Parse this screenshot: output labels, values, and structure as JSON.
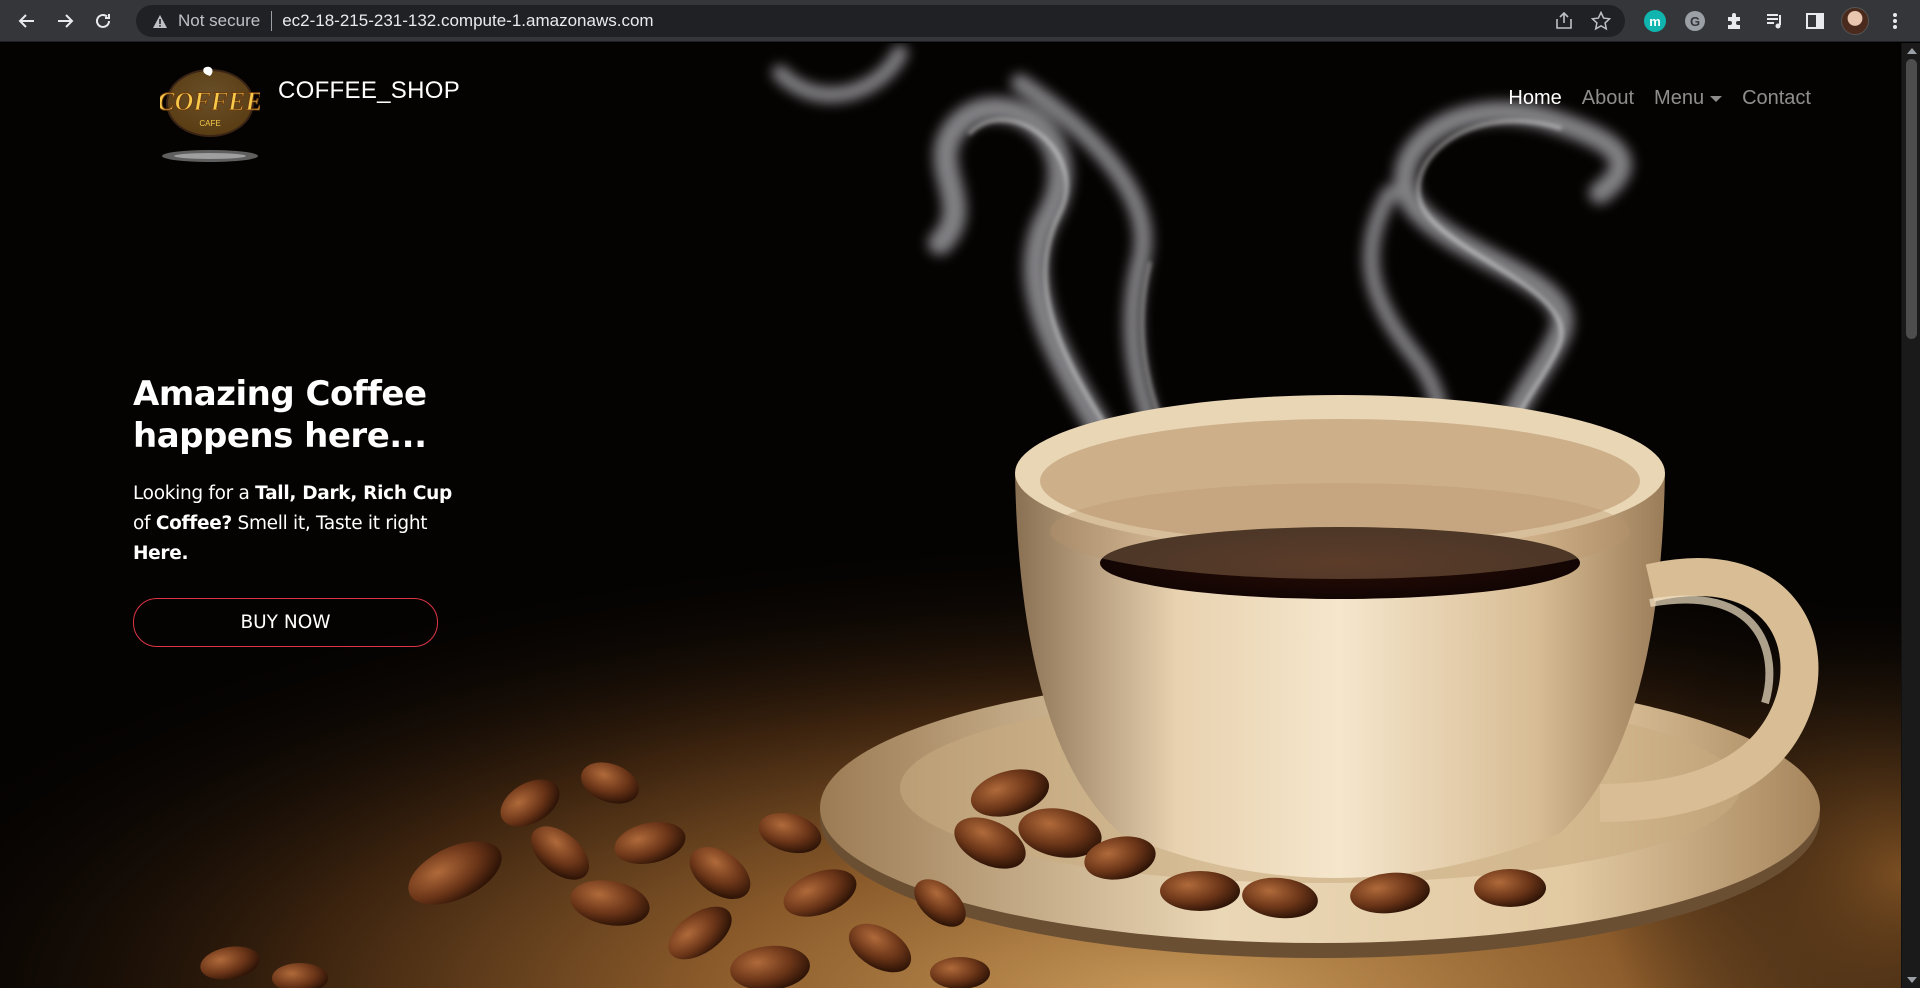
{
  "browser": {
    "security_label": "Not secure",
    "url": "ec2-18-215-231-132.compute-1.amazonaws.com",
    "extension_m_label": "m",
    "extension_g_label": "G"
  },
  "site": {
    "brand": "COFFEE_SHOP",
    "logo_text_main": "COFFEE",
    "logo_text_sub": "CAFE",
    "nav": [
      {
        "label": "Home",
        "active": true
      },
      {
        "label": "About",
        "active": false
      },
      {
        "label": "Menu",
        "active": false,
        "dropdown": true
      },
      {
        "label": "Contact",
        "active": false
      }
    ]
  },
  "hero": {
    "title_line1": "Amazing Coffee",
    "title_line2": "happens here...",
    "desc_part1": "Looking for a ",
    "desc_bold1": "Tall, Dark, Rich Cup",
    "desc_part2": " of ",
    "desc_bold2": "Coffee?",
    "desc_part3": " Smell it, Taste it right ",
    "desc_bold3": "Here.",
    "button_label": "BUY NOW"
  },
  "colors": {
    "button_border": "#dc3545",
    "chrome_bg": "#35363a",
    "omnibox_bg": "#202124"
  }
}
